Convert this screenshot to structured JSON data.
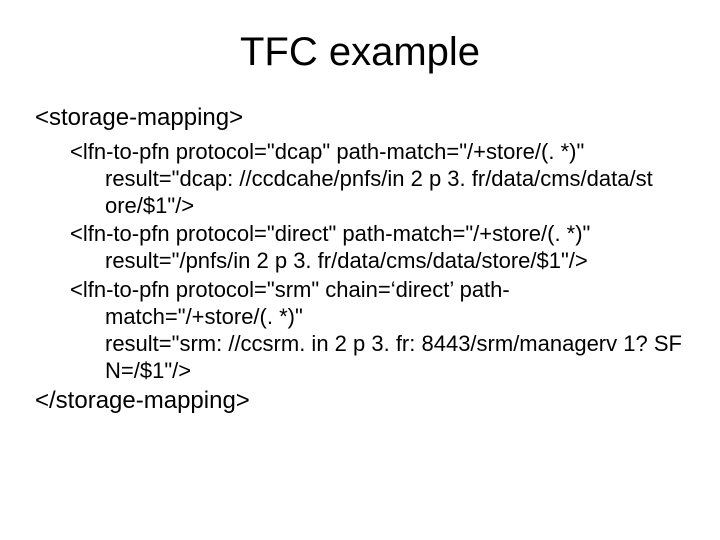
{
  "title": "TFC example",
  "storage_open": "<storage-mapping>",
  "storage_close": "</storage-mapping>",
  "entries": [
    {
      "first": "<lfn-to-pfn protocol=\"dcap\" path-match=\"/+store/(. *)\"",
      "cont": [
        "result=\"dcap: //ccdcahe/pnfs/in 2 p 3. fr/data/cms/data/st",
        "ore/$1\"/>"
      ]
    },
    {
      "first": "<lfn-to-pfn protocol=\"direct\" path-match=\"/+store/(. *)\"",
      "cont": [
        "result=\"/pnfs/in 2 p 3. fr/data/cms/data/store/$1\"/>"
      ]
    },
    {
      "first": "<lfn-to-pfn protocol=\"srm\" chain=‘direct’ path-",
      "cont": [
        "match=\"/+store/(. *)\"",
        "result=\"srm: //ccsrm. in 2 p 3. fr: 8443/srm/managerv 1? SF",
        "N=/$1\"/>"
      ]
    }
  ]
}
